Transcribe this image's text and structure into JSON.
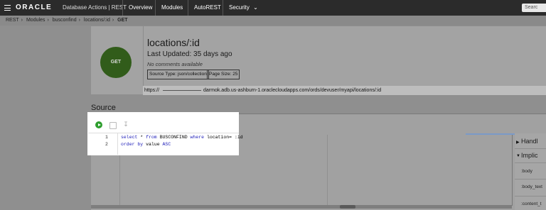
{
  "header": {
    "logo": "ORACLE",
    "product": "Database Actions | REST",
    "tabs": [
      "Overview",
      "Modules",
      "AutoREST",
      "Security"
    ],
    "search_placeholder": "Searc"
  },
  "breadcrumb": [
    "REST",
    "Modules",
    "busconfind",
    "locations/:id",
    "GET"
  ],
  "handler": {
    "method": "GET",
    "title": "locations/:id",
    "last_updated": "Last Updated: 35 days ago",
    "comments": "No comments available",
    "source_type": "Source Type: json/collection",
    "page_size": "Page Size: 25",
    "url_prefix": "https://",
    "url_rest": "darmok.adb.us-ashburn-1.oraclecloudapps.com/ords/devuser/myapi/locations/:id"
  },
  "source": {
    "title": "Source",
    "line_numbers": [
      "1",
      "2"
    ],
    "lines": [
      [
        {
          "t": "select",
          "k": true
        },
        {
          "t": " * ",
          "k": false
        },
        {
          "t": "from",
          "k": true
        },
        {
          "t": " BUSCONFIND ",
          "k": false
        },
        {
          "t": "where",
          "k": true
        },
        {
          "t": " location= :id",
          "k": false
        }
      ],
      [
        {
          "t": "order by",
          "k": true
        },
        {
          "t": " value ",
          "k": false
        },
        {
          "t": "ASC",
          "k": true
        }
      ]
    ]
  },
  "side_panel": {
    "sections": [
      "Handl",
      "Implic"
    ],
    "items": [
      ":body",
      ":body_text",
      ":content_t"
    ]
  }
}
